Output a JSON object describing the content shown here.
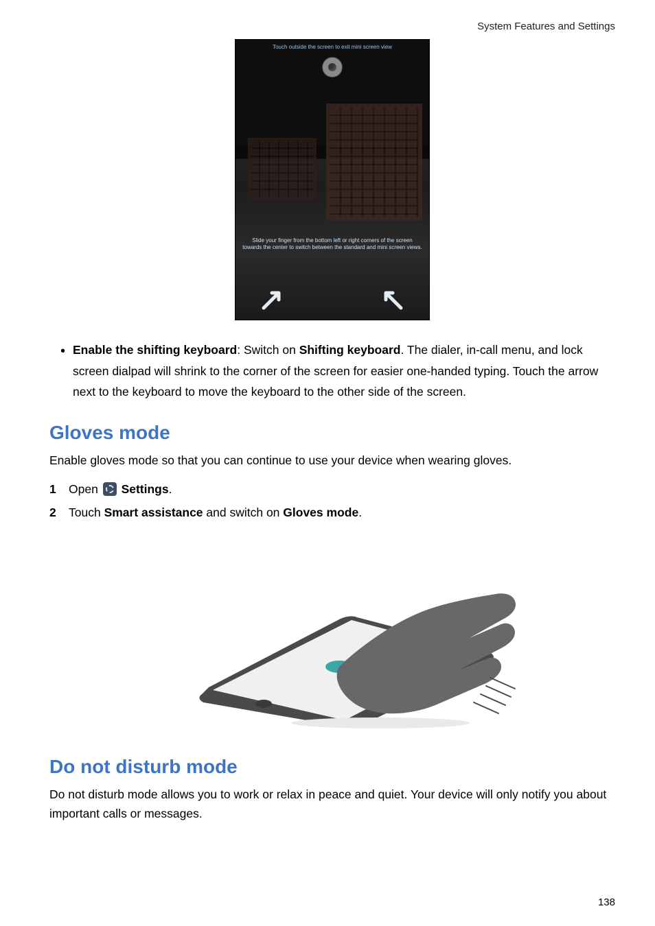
{
  "header": {
    "section": "System Features and Settings"
  },
  "phone_screenshot": {
    "top_text": "Touch outside the screen to exit mini screen view",
    "overlay_text": "Slide your finger from the bottom left or right corners of the screen towards the center to switch between the standard and mini screen views."
  },
  "bullet": {
    "prefix_bold": "Enable the shifting keyboard",
    "after_colon_1": ": Switch on ",
    "bold_2": "Shifting keyboard",
    "after_bold_2": ". The dialer, in-call menu, and lock screen dialpad will shrink to the corner of the screen for easier one-handed typing. Touch the arrow next to the keyboard to move the keyboard to the other side of the screen."
  },
  "sections": {
    "gloves": {
      "title": "Gloves mode",
      "intro": "Enable gloves mode so that you can continue to use your device when wearing gloves.",
      "step1": {
        "open": "Open ",
        "settings_label": "Settings",
        "period": "."
      },
      "step2": {
        "t1": "Touch ",
        "b1": "Smart assistance",
        "t2": " and switch on ",
        "b2": "Gloves mode",
        "t3": "."
      }
    },
    "dnd": {
      "title": "Do not disturb mode",
      "intro": "Do not disturb mode allows you to work or relax in peace and quiet. Your device will only notify you about important calls or messages."
    }
  },
  "page_number": "138"
}
